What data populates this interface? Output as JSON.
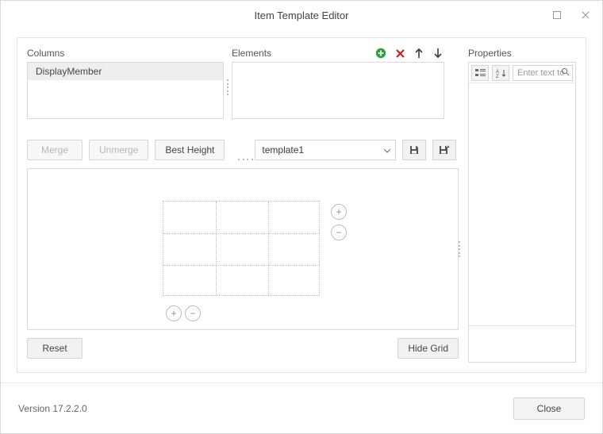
{
  "window": {
    "title": "Item Template Editor"
  },
  "columns": {
    "label": "Columns",
    "items": [
      "DisplayMember"
    ]
  },
  "elements": {
    "label": "Elements"
  },
  "properties": {
    "label": "Properties",
    "search_placeholder": "Enter text to"
  },
  "buttons": {
    "merge": "Merge",
    "unmerge": "Unmerge",
    "best_height": "Best Height",
    "reset": "Reset",
    "hide_grid": "Hide Grid",
    "close": "Close"
  },
  "template": {
    "selected": "template1"
  },
  "footer": {
    "version": "Version  17.2.2.0"
  }
}
